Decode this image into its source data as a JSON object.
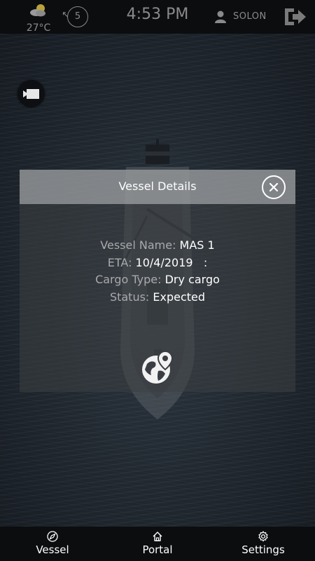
{
  "status_bar": {
    "temperature": "27°C",
    "weather_icon": "partly-cloudy-icon",
    "wind_speed": "5",
    "time": "4:53 PM",
    "username": "SOLON",
    "logout_icon": "logout-icon"
  },
  "dialog": {
    "title": "Vessel Details",
    "fields": [
      {
        "label": "Vessel Name: ",
        "value": "MAS 1"
      },
      {
        "label": "ETA: ",
        "value": "10/4/2019   :"
      },
      {
        "label": "Cargo Type: ",
        "value": "Dry cargo"
      },
      {
        "label": "Status: ",
        "value": "Expected"
      }
    ],
    "action_icon": "globe-location-icon"
  },
  "bottom_nav": {
    "items": [
      {
        "label": "Vessel",
        "icon": "navigation-icon"
      },
      {
        "label": "Portal",
        "icon": "home-icon"
      },
      {
        "label": "Settings",
        "icon": "gear-icon"
      }
    ]
  },
  "colors": {
    "bar_background": "#0c0d0f",
    "dialog_header": "#96989b",
    "label_gray": "#a9aaad",
    "text_white": "#ffffff"
  }
}
